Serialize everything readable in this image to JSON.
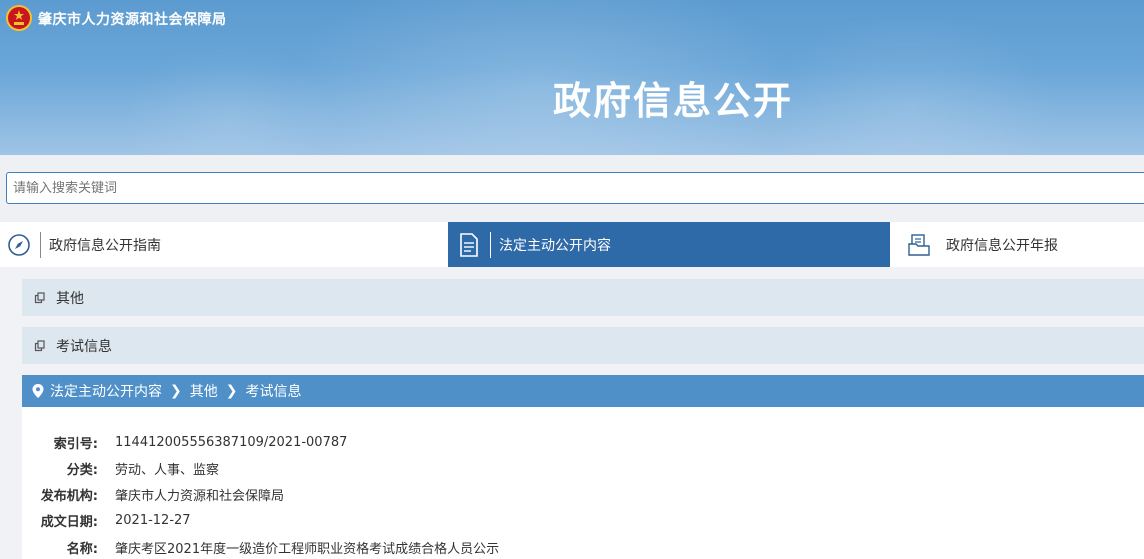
{
  "header": {
    "site_name": "肇庆市人力资源和社会保障局",
    "banner_title": "政府信息公开"
  },
  "search": {
    "placeholder": "请输入搜索关键词"
  },
  "tabs": [
    {
      "label": "政府信息公开指南",
      "icon": "compass-icon"
    },
    {
      "label": "法定主动公开内容",
      "icon": "document-icon",
      "active": true
    },
    {
      "label": "政府信息公开年报",
      "icon": "folder-report-icon"
    }
  ],
  "categories": [
    {
      "label": "其他"
    },
    {
      "label": "考试信息"
    }
  ],
  "breadcrumb": {
    "items": [
      "法定主动公开内容",
      "其他",
      "考试信息"
    ]
  },
  "info": {
    "rows": [
      {
        "key": "索引号:",
        "value": "114412005556387109/2021-00787"
      },
      {
        "key": "分类:",
        "value": "劳动、人事、监察"
      },
      {
        "key": "发布机构:",
        "value": "肇庆市人力资源和社会保障局"
      },
      {
        "key": "成文日期:",
        "value": "2021-12-27"
      },
      {
        "key": "名称:",
        "value": "肇庆考区2021年度一级造价工程师职业资格考试成绩合格人员公示"
      }
    ]
  },
  "colors": {
    "active_tab": "#2f6aa8",
    "breadcrumb_bg": "#4f90c9",
    "category_bg": "#dde7f0"
  }
}
